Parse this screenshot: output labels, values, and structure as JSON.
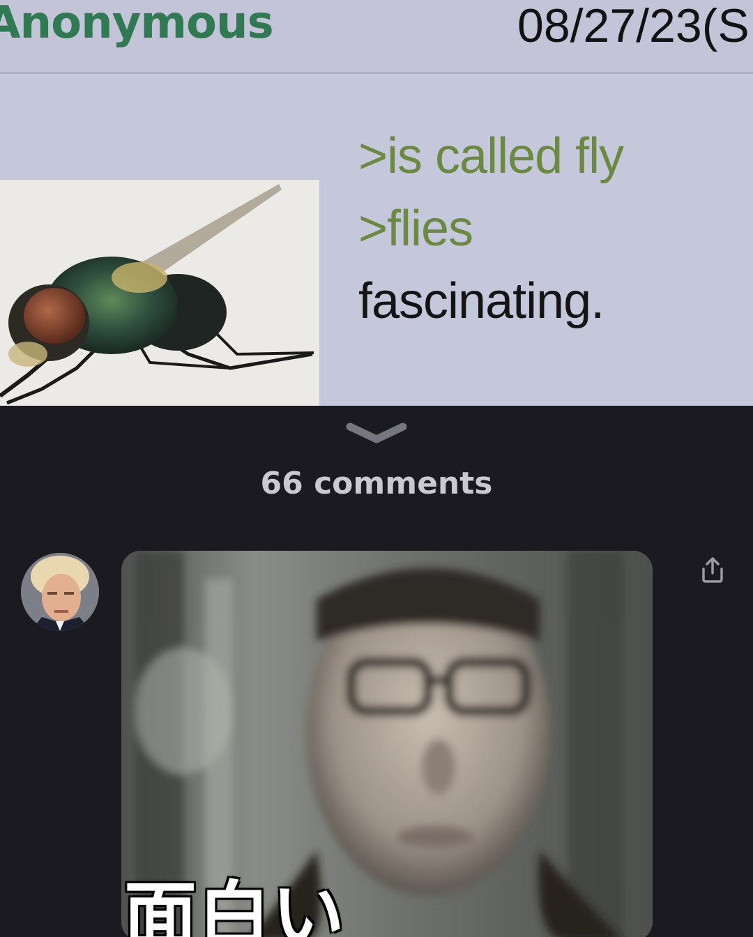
{
  "post": {
    "poster_name": "Anonymous",
    "date": "08/27/23(S",
    "greentext": [
      ">is called fly",
      ">flies"
    ],
    "body": "fascinating."
  },
  "comments": {
    "count_label": "66 comments",
    "first_comment": {
      "caption": "面白い"
    }
  },
  "icons": {
    "expand": "chevron-down-icon",
    "share": "share-icon"
  },
  "colors": {
    "post_background": "#c5c7db",
    "name_green": "#2f7a52",
    "greentext": "#6c8a3f",
    "dark_background": "#1b1a21",
    "muted_text": "#c9c9cf"
  }
}
